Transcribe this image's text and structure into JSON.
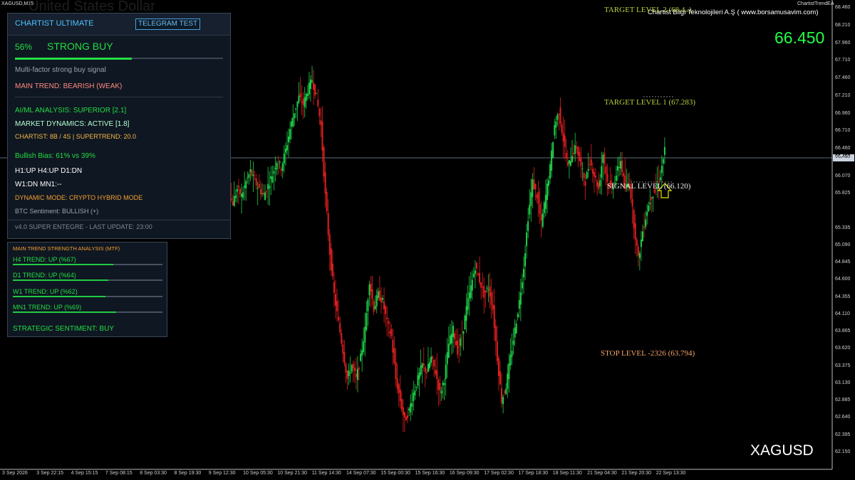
{
  "header": {
    "symbol_label": "XAGUSD,M15",
    "watermark": "United States Dollar",
    "indicator_name": "ChartistTrendEA",
    "company": "Chartist Bilgi Teknolojileri A.Ş ( www.borsamusavim.com)",
    "big_price": "66.450",
    "symbol_watermark": "XAGUSD"
  },
  "levels": {
    "target2": "TARGET LEVEL 2 (68.4..)",
    "target1": "TARGET LEVEL 1 (67.283)",
    "signal": "SIGNAL LEVEL (66.120)",
    "stop": "STOP LEVEL -2326 (63.794)"
  },
  "panel": {
    "title": "CHARTIST ULTIMATE",
    "telegram_button": "TELEGRAM TEST",
    "percent": "56%",
    "signal": "STRONG BUY",
    "strength": 0.56,
    "description": "Multi-factor strong buy signal",
    "main_trend": "MAIN TREND: BEARISH (WEAK)",
    "ai_ml": "AI/ML ANALYSIS: SUPERIOR [2.1]",
    "market_dynamics": "MARKET DYNAMICS: ACTIVE [1.8]",
    "chartist": "CHARTIST: 8B / 4S | SUPERTREND: 20.0",
    "bias": "Bullish Bias: 61% vs 39%",
    "tf1": "H1:UP H4:UP D1:DN",
    "tf2": "W1:DN MN1:--",
    "dynamic_mode": "DYNAMIC MODE: CRYPTO HYBRID MODE",
    "btc": "BTC Sentiment: BULLISH (+)",
    "footer": "v4.0 SUPER ENTEGRE - LAST UPDATE: 23:00"
  },
  "mtf": {
    "title": "MAIN TREND STRENGTH ANALYSIS (MTF)",
    "items": [
      {
        "label": "H4 TREND: UP (%67)",
        "value": 0.67
      },
      {
        "label": "D1 TREND: UP (%64)",
        "value": 0.64
      },
      {
        "label": "W1 TREND: UP (%62)",
        "value": 0.62
      },
      {
        "label": "MN1 TREND: UP (%69)",
        "value": 0.69
      }
    ],
    "sentiment": "STRATEGIC SENTIMENT: BUY"
  },
  "chart_data": {
    "type": "candlestick",
    "current_price": "66.450",
    "price_ticks": [
      "68.460",
      "68.210",
      "67.960",
      "67.710",
      "67.460",
      "67.210",
      "66.960",
      "66.710",
      "66.460",
      "66.450",
      "66.315",
      "66.070",
      "65.825",
      "65.335",
      "65.090",
      "64.845",
      "64.600",
      "64.355",
      "64.110",
      "63.865",
      "63.620",
      "63.375",
      "63.130",
      "62.885",
      "62.640",
      "62.395",
      "62.150"
    ],
    "time_ticks": [
      "3 Sep 2026",
      "3 Sep 22:15",
      "4 Sep 15:15",
      "7 Sep 08:15",
      "8 Sep 03:30",
      "8 Sep 19:30",
      "9 Sep 12:30",
      "10 Sep 05:30",
      "10 Sep 21:30",
      "11 Sep 14:30",
      "14 Sep 07:30",
      "15 Sep 00:30",
      "15 Sep 16:30",
      "16 Sep 09:30",
      "17 Sep 02:30",
      "17 Sep 18:30",
      "18 Sep 11:30",
      "21 Sep 04:30",
      "21 Sep 20:30",
      "22 Sep 13:30"
    ],
    "price_path": [
      [
        0,
        67.05
      ],
      [
        1,
        67.1
      ],
      [
        2,
        67.2
      ],
      [
        3,
        67.35
      ],
      [
        4,
        67.2
      ],
      [
        5,
        67.1
      ],
      [
        6,
        66.95
      ],
      [
        7,
        66.85
      ],
      [
        8,
        66.9
      ],
      [
        9,
        66.85
      ],
      [
        10,
        66.7
      ],
      [
        11,
        66.55
      ],
      [
        12,
        66.5
      ],
      [
        13,
        66.6
      ],
      [
        14,
        66.45
      ],
      [
        15,
        66.5
      ],
      [
        16,
        66.35
      ],
      [
        17,
        66.2
      ],
      [
        18,
        66.0
      ],
      [
        19,
        65.8
      ],
      [
        20,
        65.7
      ],
      [
        21,
        65.9
      ],
      [
        22,
        65.8
      ],
      [
        23,
        66.0
      ],
      [
        24,
        66.15
      ],
      [
        25,
        66.0
      ],
      [
        26,
        65.9
      ],
      [
        27,
        65.8
      ],
      [
        28,
        65.95
      ],
      [
        29,
        66.1
      ],
      [
        30,
        66.3
      ],
      [
        31,
        66.2
      ],
      [
        32,
        66.45
      ],
      [
        33,
        66.75
      ],
      [
        34,
        67.0
      ],
      [
        35,
        67.2
      ],
      [
        36,
        67.1
      ],
      [
        37,
        67.3
      ],
      [
        38,
        67.45
      ],
      [
        39,
        67.2
      ],
      [
        40,
        66.8
      ],
      [
        41,
        65.8
      ],
      [
        42,
        65.0
      ],
      [
        43,
        64.4
      ],
      [
        44,
        64.0
      ],
      [
        45,
        63.6
      ],
      [
        46,
        63.2
      ],
      [
        47,
        63.4
      ],
      [
        48,
        63.2
      ],
      [
        49,
        63.5
      ],
      [
        50,
        63.9
      ],
      [
        51,
        64.6
      ],
      [
        52,
        64.2
      ],
      [
        53,
        64.4
      ],
      [
        54,
        64.3
      ],
      [
        55,
        64.0
      ],
      [
        56,
        63.8
      ],
      [
        57,
        63.2
      ],
      [
        58,
        62.9
      ],
      [
        59,
        62.6
      ],
      [
        60,
        62.75
      ],
      [
        61,
        63.0
      ],
      [
        62,
        63.2
      ],
      [
        63,
        63.4
      ],
      [
        64,
        63.3
      ],
      [
        65,
        63.5
      ],
      [
        66,
        63.3
      ],
      [
        67,
        63.0
      ],
      [
        68,
        63.2
      ],
      [
        69,
        63.7
      ],
      [
        70,
        63.9
      ],
      [
        71,
        63.6
      ],
      [
        72,
        63.8
      ],
      [
        73,
        64.2
      ],
      [
        74,
        64.5
      ],
      [
        75,
        64.8
      ],
      [
        76,
        64.6
      ],
      [
        77,
        64.4
      ],
      [
        78,
        64.5
      ],
      [
        79,
        64.2
      ],
      [
        80,
        63.5
      ],
      [
        81,
        62.9
      ],
      [
        82,
        63.1
      ],
      [
        83,
        63.5
      ],
      [
        84,
        63.9
      ],
      [
        85,
        64.3
      ],
      [
        86,
        64.8
      ],
      [
        87,
        65.5
      ],
      [
        88,
        66.0
      ],
      [
        89,
        65.8
      ],
      [
        90,
        65.4
      ],
      [
        91,
        65.8
      ],
      [
        92,
        66.2
      ],
      [
        93,
        66.8
      ],
      [
        94,
        67.0
      ],
      [
        95,
        66.6
      ],
      [
        96,
        66.2
      ],
      [
        97,
        66.4
      ],
      [
        98,
        66.5
      ],
      [
        99,
        66.2
      ],
      [
        100,
        66.0
      ],
      [
        101,
        66.3
      ],
      [
        102,
        66.1
      ],
      [
        103,
        65.9
      ],
      [
        104,
        66.4
      ],
      [
        105,
        66.0
      ],
      [
        106,
        65.9
      ],
      [
        107,
        66.1
      ],
      [
        108,
        66.3
      ],
      [
        109,
        65.9
      ],
      [
        110,
        66.0
      ],
      [
        111,
        65.4
      ],
      [
        112,
        64.9
      ],
      [
        113,
        65.3
      ],
      [
        114,
        65.6
      ],
      [
        115,
        65.8
      ],
      [
        116,
        65.9
      ],
      [
        117,
        66.1
      ],
      [
        118,
        66.45
      ]
    ]
  }
}
